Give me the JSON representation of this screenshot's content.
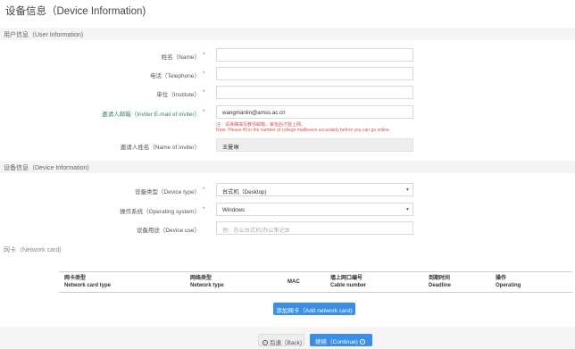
{
  "page": {
    "title": "设备信息（Device Information)"
  },
  "user_section": {
    "title": "用户信息（User Information)",
    "name_label": "姓名（Name）",
    "phone_label": "电话（Telephone）",
    "institute_label": "单位（Institute）",
    "inviter_email_label": "邀请人邮箱（Inviter E-mail of inviter）",
    "inviter_email_value": "wangmanlin@amss.ac.cn",
    "note_cn": "注：请准确填写教师邮箱，审批后才能上网。",
    "note_en": "Note: Please fill in the number of college mailboxes accurately before you can go online.",
    "inviter_name_label": "邀请人姓名（Name of inviter）",
    "inviter_name_value": "王曼琳",
    "required_mark": "*"
  },
  "device_section": {
    "title": "设备信息（Device Information)",
    "type_label": "设备类型（Device type）",
    "type_value": "台式机（Desktop)",
    "os_label": "操作系统（Operating system）",
    "os_value": "Windows",
    "use_label": "设备用途（Device use）",
    "use_placeholder": "例：办公台式机/办公笔记本"
  },
  "network_section": {
    "title": "网卡（Network card)",
    "columns": [
      {
        "cn": "网卡类型",
        "en": "Network card type"
      },
      {
        "cn": "网络类型",
        "en": "Network type"
      },
      {
        "cn": "",
        "en": "MAC"
      },
      {
        "cn": "墙上网口编号",
        "en": "Cable number"
      },
      {
        "cn": "到期时间",
        "en": "Deadline"
      },
      {
        "cn": "操作",
        "en": "Operating"
      }
    ],
    "add_button": "添加网卡（Add network card)"
  },
  "footer": {
    "back_label": "后退（Back)",
    "continue_label": "继续（Continue)"
  },
  "colors": {
    "primary": "#3a8ee6",
    "required": "#e05555",
    "link_label": "#2e8b57"
  }
}
